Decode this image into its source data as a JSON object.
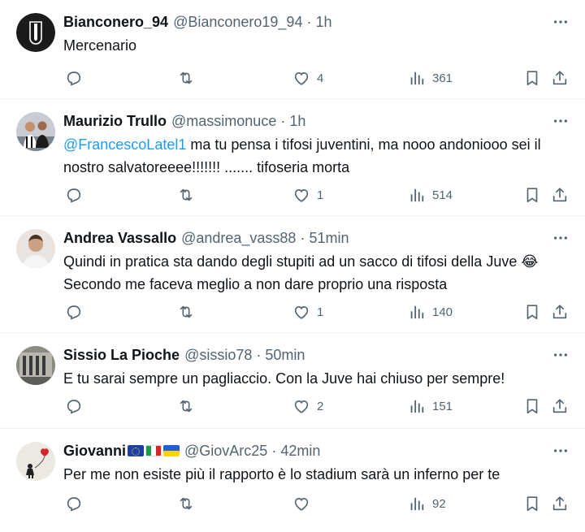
{
  "tweets": [
    {
      "name": "Bianconero_94",
      "handle": "@Bianconero19_94",
      "dot": "·",
      "time": "1h",
      "text": "Mercenario",
      "replies": "",
      "retweets": "",
      "likes": "4",
      "views": "361",
      "avatar": "juventus-logo-avatar"
    },
    {
      "name": "Maurizio Trullo",
      "handle": "@massimonuce",
      "dot": "·",
      "time": "1h",
      "mention": "@FrancescoLatel1",
      "text_line1": " ma tu pensa i tifosi juventini, ma nooo andoniooo sei il",
      "text_line2": "nostro salvatoreeee!!!!!!! ....... tifoseria morta",
      "replies": "",
      "retweets": "",
      "likes": "1",
      "views": "514",
      "avatar": "players-photo-avatar"
    },
    {
      "name": "Andrea Vassallo",
      "handle": "@andrea_vass88",
      "dot": "·",
      "time": "51min",
      "text_line1": "Quindi in pratica sta dando degli stupiti ad un sacco di tifosi della Juve 😂",
      "text_line2": "Secondo me faceva meglio a non dare proprio una risposta",
      "replies": "",
      "retweets": "",
      "likes": "1",
      "views": "140",
      "avatar": "man-portrait-avatar"
    },
    {
      "name": "Sissio La Pioche",
      "handle": "@sissio78",
      "dot": "·",
      "time": "50min",
      "text": "E tu sarai sempre un pagliaccio. Con la Juve hai chiuso per sempre!",
      "replies": "",
      "retweets": "",
      "likes": "2",
      "views": "151",
      "avatar": "stadium-avatar"
    },
    {
      "name": "Giovanni",
      "handle": "@GiovArc25",
      "dot": "·",
      "time": "42min",
      "text": "Per me non esiste più il rapporto è lo stadium sarà un inferno per te",
      "replies": "",
      "retweets": "",
      "likes": "",
      "views": "92",
      "avatar": "girl-with-balloon-avatar"
    }
  ],
  "colors": {
    "text": "#0f1419",
    "secondary": "#536471",
    "link": "#1d9bf0",
    "divider": "#eff3f4"
  }
}
